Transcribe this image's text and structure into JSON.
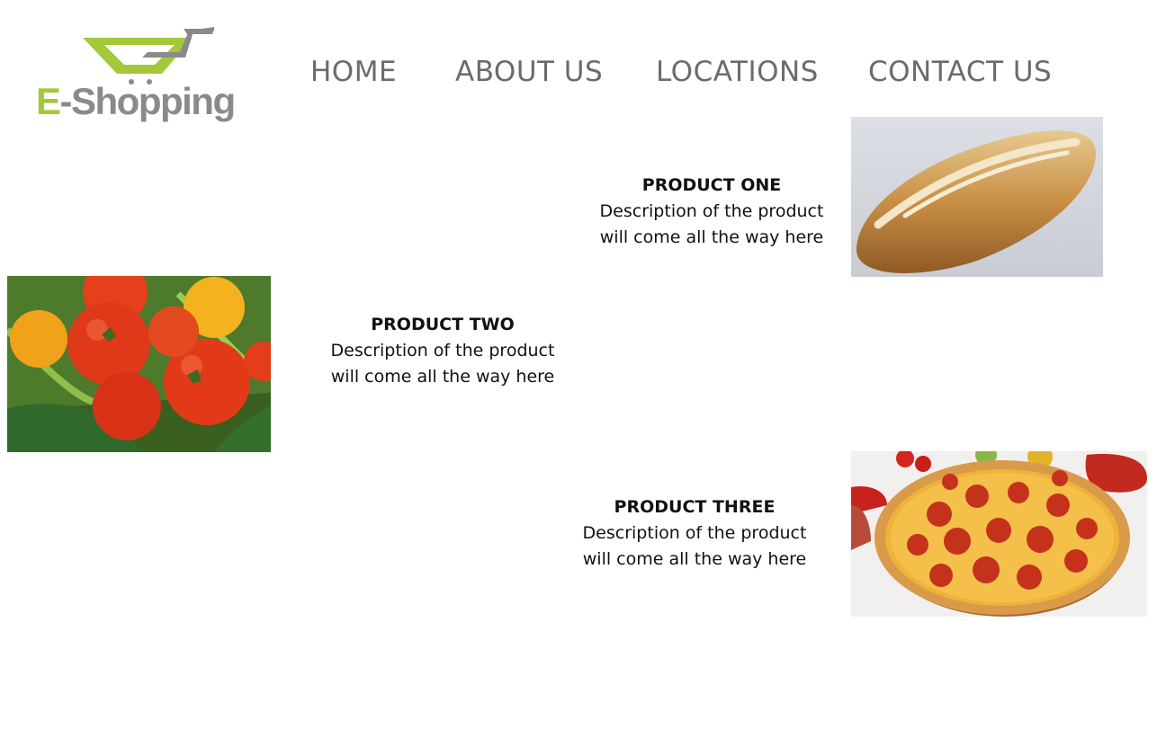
{
  "logo": {
    "prefix": "E",
    "rest": "-Shopping",
    "icon": "shopping-cart-icon"
  },
  "nav": {
    "items": [
      {
        "label": "HOME"
      },
      {
        "label": "ABOUT US"
      },
      {
        "label": "LOCATIONS"
      },
      {
        "label": "CONTACT US"
      }
    ]
  },
  "products": [
    {
      "title": "PRODUCT ONE",
      "desc_line1": "Description of the product",
      "desc_line2": "will come all the way here",
      "image": "bread-image"
    },
    {
      "title": "PRODUCT TWO",
      "desc_line1": "Description of the product",
      "desc_line2": "will come all the way here",
      "image": "vegetables-image"
    },
    {
      "title": "PRODUCT THREE",
      "desc_line1": "Description of the product",
      "desc_line2": "will come all the way here",
      "image": "pizza-image"
    }
  ],
  "colors": {
    "brand_green": "#a3c93a",
    "brand_gray": "#8a8a8a",
    "nav_text": "#6b6b6b"
  }
}
